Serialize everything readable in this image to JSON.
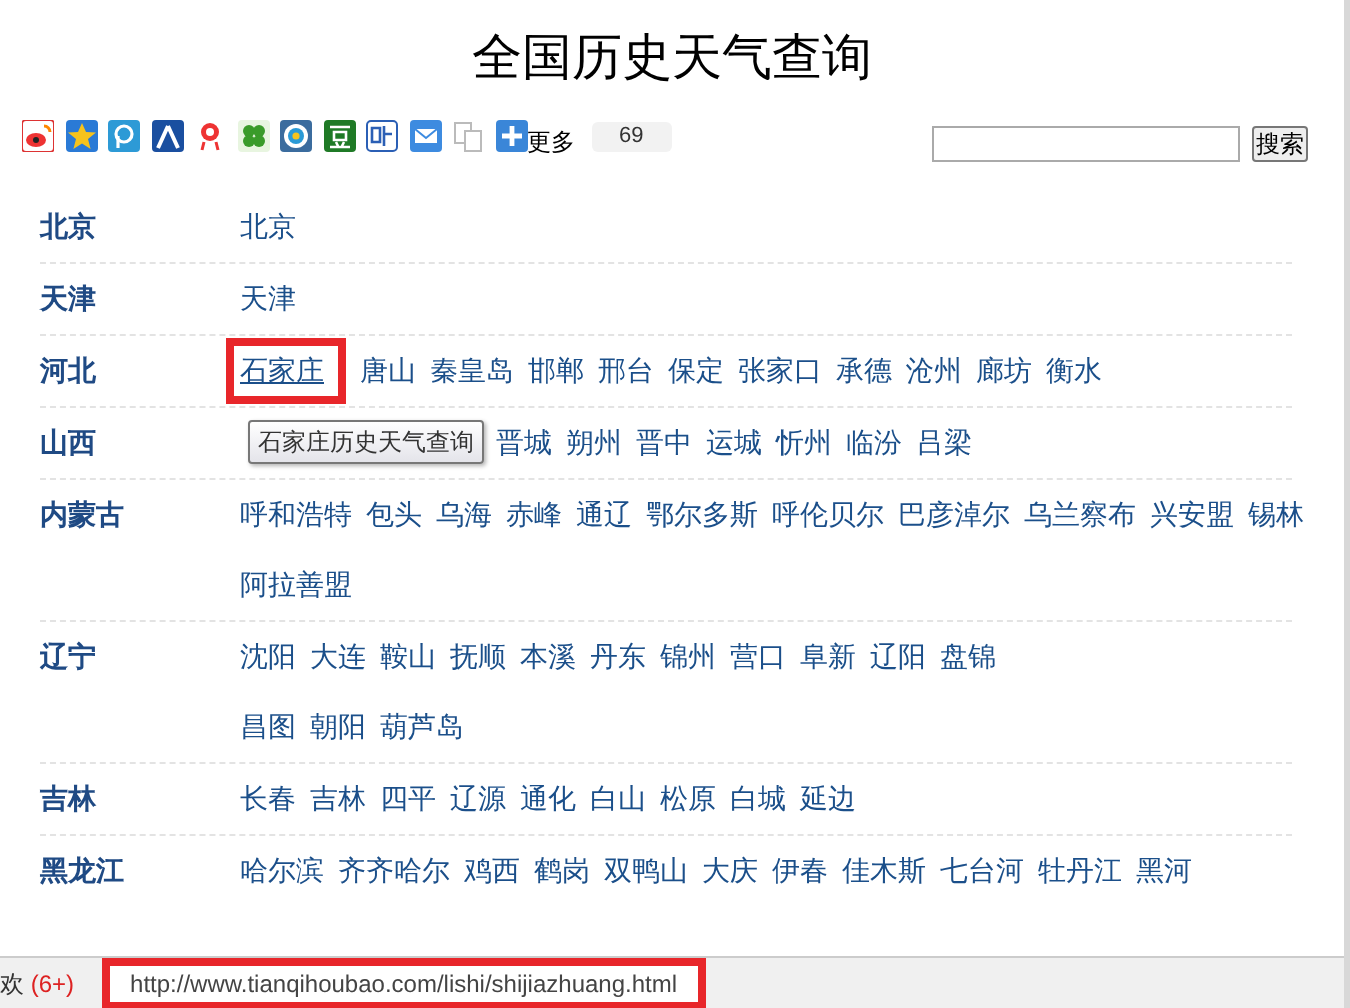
{
  "title": "全国历史天气查询",
  "share_bar": {
    "icons": [
      {
        "kind": "weibo"
      },
      {
        "kind": "qzone"
      },
      {
        "kind": "pengyou"
      },
      {
        "kind": "renren"
      },
      {
        "kind": "kaixin"
      },
      {
        "kind": "clover"
      },
      {
        "kind": "tencent"
      },
      {
        "kind": "douban"
      },
      {
        "kind": "tieba"
      },
      {
        "kind": "mail"
      },
      {
        "kind": "copy"
      },
      {
        "kind": "more"
      }
    ],
    "more_label": "更多",
    "count": "69"
  },
  "search": {
    "button": "搜索"
  },
  "provinces": [
    {
      "name": "北京",
      "lines": [
        [
          {
            "name": "北京",
            "highlighted": false
          }
        ]
      ]
    },
    {
      "name": "天津",
      "lines": [
        [
          {
            "name": "天津",
            "highlighted": false
          }
        ]
      ]
    },
    {
      "name": "河北",
      "lines": [
        [
          {
            "name": "石家庄",
            "highlighted": true
          },
          {
            "name": "唐山",
            "highlighted": false
          },
          {
            "name": "秦皇岛",
            "highlighted": false
          },
          {
            "name": "邯郸",
            "highlighted": false
          },
          {
            "name": "邢台",
            "highlighted": false
          },
          {
            "name": "保定",
            "highlighted": false
          },
          {
            "name": "张家口",
            "highlighted": false
          },
          {
            "name": "承德",
            "highlighted": false
          },
          {
            "name": "沧州",
            "highlighted": false
          },
          {
            "name": "廊坊",
            "highlighted": false
          },
          {
            "name": "衡水",
            "highlighted": false
          }
        ]
      ]
    },
    {
      "name": "山西",
      "tooltip": "石家庄历史天气查询",
      "lines": [
        [
          {
            "name": "晋城",
            "highlighted": false
          },
          {
            "name": "朔州",
            "highlighted": false
          },
          {
            "name": "晋中",
            "highlighted": false
          },
          {
            "name": "运城",
            "highlighted": false
          },
          {
            "name": "忻州",
            "highlighted": false
          },
          {
            "name": "临汾",
            "highlighted": false
          },
          {
            "name": "吕梁",
            "highlighted": false
          }
        ]
      ]
    },
    {
      "name": "内蒙古",
      "lines": [
        [
          {
            "name": "呼和浩特",
            "highlighted": false
          },
          {
            "name": "包头",
            "highlighted": false
          },
          {
            "name": "乌海",
            "highlighted": false
          },
          {
            "name": "赤峰",
            "highlighted": false
          },
          {
            "name": "通辽",
            "highlighted": false
          },
          {
            "name": "鄂尔多斯",
            "highlighted": false
          },
          {
            "name": "呼伦贝尔",
            "highlighted": false
          },
          {
            "name": "巴彦淖尔",
            "highlighted": false
          },
          {
            "name": "乌兰察布",
            "highlighted": false
          },
          {
            "name": "兴安盟",
            "highlighted": false
          },
          {
            "name": "锡林",
            "highlighted": false
          }
        ],
        [
          {
            "name": "阿拉善盟",
            "highlighted": false
          }
        ]
      ]
    },
    {
      "name": "辽宁",
      "lines": [
        [
          {
            "name": "沈阳",
            "highlighted": false
          },
          {
            "name": "大连",
            "highlighted": false
          },
          {
            "name": "鞍山",
            "highlighted": false
          },
          {
            "name": "抚顺",
            "highlighted": false
          },
          {
            "name": "本溪",
            "highlighted": false
          },
          {
            "name": "丹东",
            "highlighted": false
          },
          {
            "name": "锦州",
            "highlighted": false
          },
          {
            "name": "营口",
            "highlighted": false
          },
          {
            "name": "阜新",
            "highlighted": false
          },
          {
            "name": "辽阳",
            "highlighted": false
          },
          {
            "name": "盘锦",
            "highlighted": false
          }
        ],
        [
          {
            "name": "昌图",
            "highlighted": false
          },
          {
            "name": "朝阳",
            "highlighted": false
          },
          {
            "name": "葫芦岛",
            "highlighted": false
          }
        ]
      ]
    },
    {
      "name": "吉林",
      "lines": [
        [
          {
            "name": "长春",
            "highlighted": false
          },
          {
            "name": "吉林",
            "highlighted": false
          },
          {
            "name": "四平",
            "highlighted": false
          },
          {
            "name": "辽源",
            "highlighted": false
          },
          {
            "name": "通化",
            "highlighted": false
          },
          {
            "name": "白山",
            "highlighted": false
          },
          {
            "name": "松原",
            "highlighted": false
          },
          {
            "name": "白城",
            "highlighted": false
          },
          {
            "name": "延边",
            "highlighted": false
          }
        ]
      ]
    },
    {
      "name": "黑龙江",
      "lines": [
        [
          {
            "name": "哈尔滨",
            "highlighted": false
          },
          {
            "name": "齐齐哈尔",
            "highlighted": false
          },
          {
            "name": "鸡西",
            "highlighted": false
          },
          {
            "name": "鹤岗",
            "highlighted": false
          },
          {
            "name": "双鸭山",
            "highlighted": false
          },
          {
            "name": "大庆",
            "highlighted": false
          },
          {
            "name": "伊春",
            "highlighted": false
          },
          {
            "name": "佳木斯",
            "highlighted": false
          },
          {
            "name": "七台河",
            "highlighted": false
          },
          {
            "name": "牡丹江",
            "highlighted": false
          },
          {
            "name": "黑河",
            "highlighted": false
          }
        ]
      ]
    }
  ],
  "status_bar": {
    "left_text": "欢",
    "left_count": "(6+)",
    "url": "http://www.tianqihoubao.com/lishi/shijiazhuang.html",
    "url_highlighted": true
  }
}
